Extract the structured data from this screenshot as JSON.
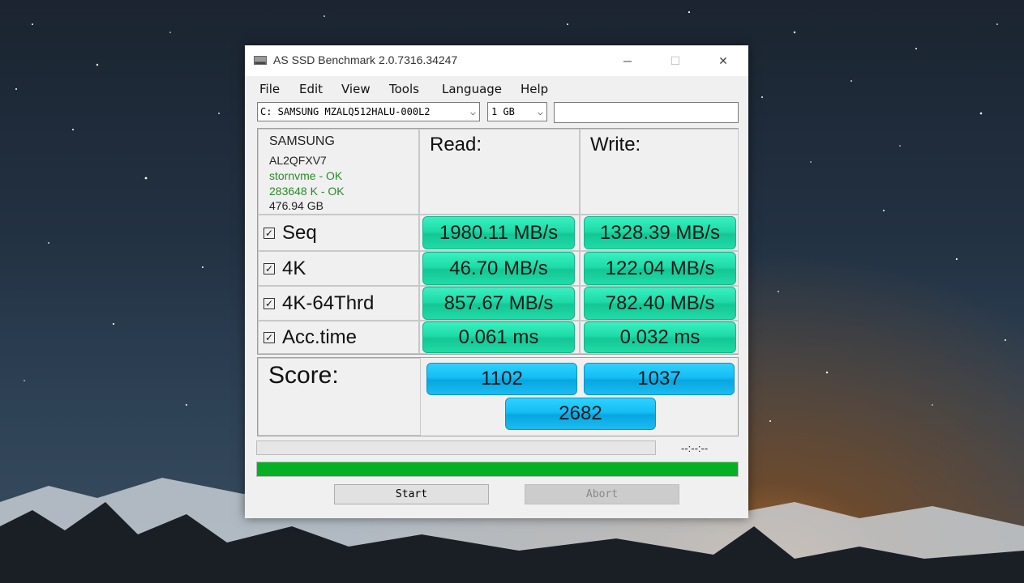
{
  "window": {
    "title": "AS SSD Benchmark 2.0.7316.34247",
    "minimize": "─",
    "maximize": "☐",
    "close": "✕"
  },
  "menu": [
    "File",
    "Edit",
    "View",
    "Tools",
    "Language",
    "Help"
  ],
  "toolbar": {
    "drive": "C: SAMSUNG MZALQ512HALU-000L2",
    "size": "1 GB",
    "text_value": ""
  },
  "drive_info": {
    "vendor": "SAMSUNG",
    "firmware": "AL2QFXV7",
    "driver": "stornvme - OK",
    "alignment": "283648 K - OK",
    "capacity": "476.94 GB"
  },
  "columns": {
    "read": "Read:",
    "write": "Write:"
  },
  "rows": [
    {
      "label": "Seq",
      "check": "✓",
      "read": "1980.11 MB/s",
      "write": "1328.39 MB/s"
    },
    {
      "label": "4K",
      "check": "✓",
      "read": "46.70 MB/s",
      "write": "122.04 MB/s"
    },
    {
      "label": "4K-64Thrd",
      "check": "✓",
      "read": "857.67 MB/s",
      "write": "782.40 MB/s"
    },
    {
      "label": "Acc.time",
      "check": "✓",
      "read": "0.061 ms",
      "write": "0.032 ms"
    }
  ],
  "score": {
    "label": "Score:",
    "read": "1102",
    "write": "1037",
    "total": "2682"
  },
  "status": {
    "time": "--:--:--",
    "progress_fraction": 1.0
  },
  "buttons": {
    "start": "Start",
    "abort": "Abort"
  },
  "colors": {
    "result_green": "#1edba8",
    "score_blue": "#14bdf5",
    "progress_green": "#06b025"
  }
}
